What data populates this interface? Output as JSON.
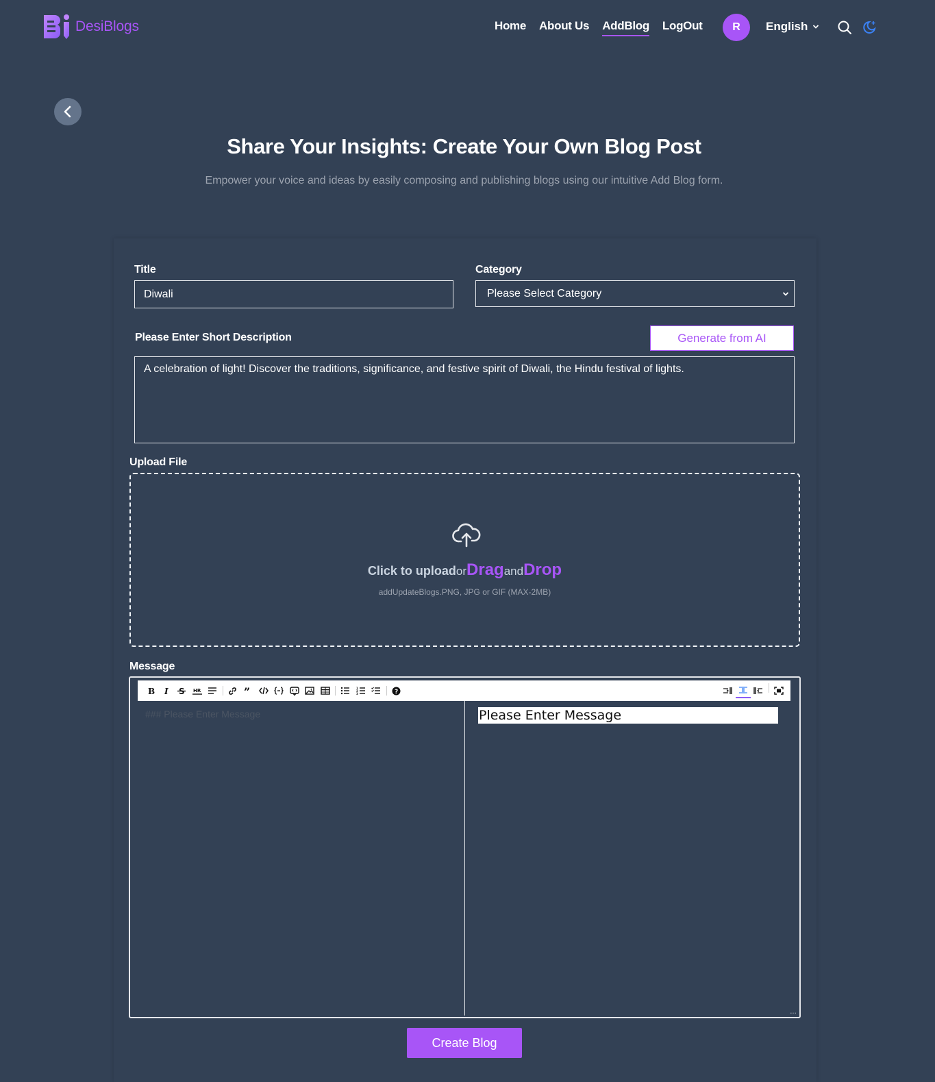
{
  "brand": {
    "name": "DesiBlogs",
    "accent": "#a855f7"
  },
  "nav": {
    "items": [
      {
        "label": "Home"
      },
      {
        "label": "About Us"
      },
      {
        "label": "AddBlog"
      },
      {
        "label": "LogOut"
      }
    ],
    "active": "AddBlog",
    "avatar_initial": "R",
    "language": "English"
  },
  "hero": {
    "title": "Share Your Insights: Create Your Own Blog Post",
    "subtitle": "Empower your voice and ideas by easily composing and publishing blogs using our intuitive Add Blog form."
  },
  "form": {
    "title_label": "Title",
    "title_value": "Diwali",
    "category_label": "Category",
    "category_value": "Please Select Category",
    "description_label": "Please Enter Short Description",
    "ai_button": "Generate from AI",
    "description_value": "A celebration of light! Discover the traditions, significance, and festive spirit of Diwali, the Hindu festival of lights.",
    "upload_label": "Upload File",
    "upload": {
      "click_text": "Click to upload",
      "or_text": "or",
      "drag_text": "Drag",
      "and_text": "and",
      "drop_text": "Drop",
      "hint": "addUpdateBlogs.PNG, JPG or GIF (MAX-2MB)"
    },
    "message_label": "Message",
    "editor_placeholder": "### Please Enter Message",
    "preview_text": "Please Enter Message",
    "toolbar_left": [
      "bold-icon",
      "italic-icon",
      "strikethrough-icon",
      "hr-icon",
      "title-icon",
      "link-icon",
      "quote-icon",
      "code-icon",
      "code-block-icon",
      "comment-icon",
      "image-icon",
      "table-icon",
      "unordered-list-icon",
      "ordered-list-icon",
      "checked-list-icon",
      "help-icon"
    ],
    "toolbar_right": [
      "edit-mode-icon",
      "live-mode-icon",
      "preview-mode-icon",
      "fullscreen-icon"
    ],
    "submit_label": "Create Blog"
  }
}
